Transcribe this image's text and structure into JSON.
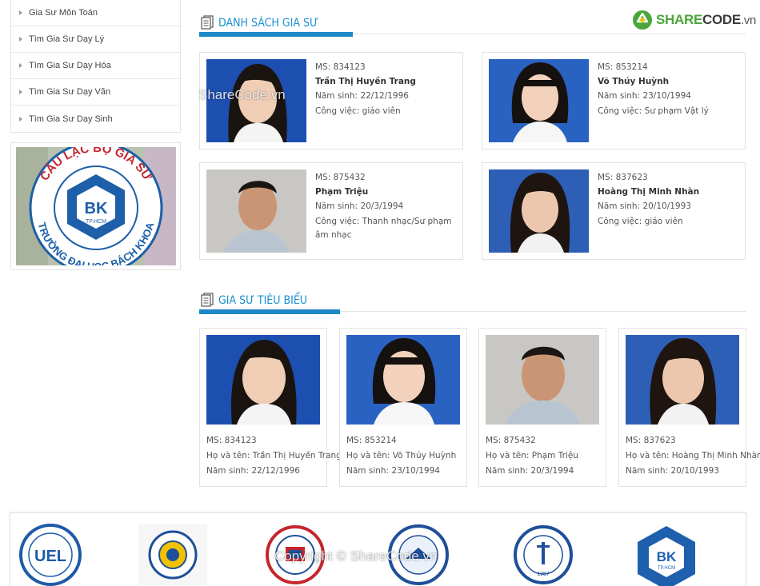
{
  "sidebar": {
    "items": [
      {
        "label": "Gia Sư Môn Toán"
      },
      {
        "label": "Tìm Gia Sư Dạy Lý"
      },
      {
        "label": "Tìm Gia Sư Dạy Hóa"
      },
      {
        "label": "Tìm Gia Sư Dạy Văn"
      },
      {
        "label": "Tìm Gia Sư Dạy Sinh"
      }
    ],
    "club_logo": {
      "arc_text": "CÂU LẠC BỘ GIA SƯ",
      "bottom_text": "TRƯỜNG ĐẠI HỌC BÁCH KHOA",
      "bk": "BK",
      "bk_sub": "TP.HCM"
    }
  },
  "brand": {
    "prefix": "SHARE",
    "main": "CODE",
    "suffix": ".vn"
  },
  "sections": {
    "list_title": "DANH SÁCH GIA SƯ",
    "featured_title": "GIA SƯ TIÊU BIỂU"
  },
  "labels": {
    "code": "MS: ",
    "birth": "Năm sinh: ",
    "job": "Công việc: ",
    "fullname": "Họ và tên: "
  },
  "tutors": [
    {
      "code": "834123",
      "name": "Trần Thị Huyền Trang",
      "birth": "22/12/1996",
      "job": "giáo viên"
    },
    {
      "code": "853214",
      "name": "Võ Thúy Huỳnh",
      "birth": "23/10/1994",
      "job": "Sư phạm Vật lý"
    },
    {
      "code": "875432",
      "name": "Phạm Triệu",
      "birth": "20/3/1994",
      "job": "Thanh nhạc/Sư phạm âm nhạc"
    },
    {
      "code": "837623",
      "name": "Hoàng Thị Minh Nhàn",
      "birth": "20/10/1993",
      "job": "giáo viên"
    }
  ],
  "watermarks": {
    "top": "ShareCode.vn",
    "bottom": "Copyright © ShareCode.vn"
  },
  "partners": [
    {
      "name": "UEL",
      "icon": "uel-logo"
    },
    {
      "name": "",
      "icon": "university-seal-logo"
    },
    {
      "name": "",
      "icon": "law-university-logo"
    },
    {
      "name": "",
      "icon": "pedagogy-university-logo"
    },
    {
      "name": "1957",
      "icon": "medical-university-logo"
    },
    {
      "name": "BK",
      "sub": "TP.HCM",
      "icon": "bk-logo"
    }
  ],
  "colors": {
    "accent": "#1a8fd0",
    "brand_green": "#4aa63a"
  }
}
